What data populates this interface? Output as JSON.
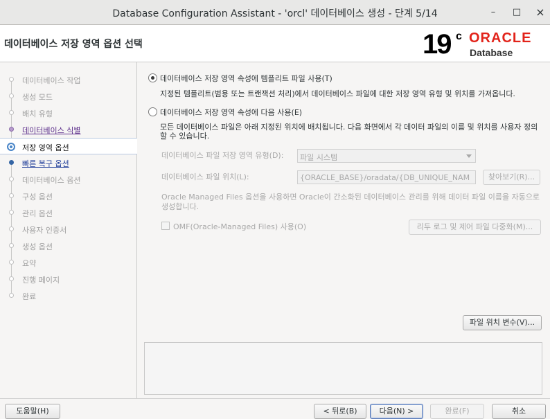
{
  "window": {
    "title": "Database Configuration Assistant - 'orcl' 데이터베이스 생성 - 단계 5/14",
    "minimize_glyph": "–",
    "maximize_glyph": "□",
    "close_glyph": "×"
  },
  "header": {
    "title": "데이터베이스 저장 영역 옵션 선택",
    "logo": {
      "version": "19",
      "superscript": "c",
      "brand": "ORACLE",
      "product": "Database"
    }
  },
  "sidebar": {
    "steps": [
      {
        "label": "데이터베이스 작업",
        "state": "pending"
      },
      {
        "label": "생성 모드",
        "state": "pending"
      },
      {
        "label": "배치 유형",
        "state": "pending"
      },
      {
        "label": "데이터베이스 식별",
        "state": "done"
      },
      {
        "label": "저장 영역 옵션",
        "state": "current"
      },
      {
        "label": "빠른 복구 옵션",
        "state": "next"
      },
      {
        "label": "데이터베이스 옵션",
        "state": "pending"
      },
      {
        "label": "구성 옵션",
        "state": "pending"
      },
      {
        "label": "관리 옵션",
        "state": "pending"
      },
      {
        "label": "사용자 인증서",
        "state": "pending"
      },
      {
        "label": "생성 옵션",
        "state": "pending"
      },
      {
        "label": "요약",
        "state": "pending"
      },
      {
        "label": "진행 페이지",
        "state": "pending"
      },
      {
        "label": "완료",
        "state": "pending"
      }
    ]
  },
  "main": {
    "option_template": {
      "label": "데이터베이스 저장 영역 속성에 템플리트 파일 사용(T)",
      "description": "지정된 템플리트(범용 또는 트랜잭션 처리)에서 데이터베이스 파일에 대한 저장 영역 유형 및 위치를 가져옵니다.",
      "selected": true
    },
    "option_custom": {
      "label": "데이터베이스 저장 영역 속성에 다음 사용(E)",
      "description": "모든 데이터베이스 파일은 아래 지정된 위치에 배치됩니다. 다음 화면에서 각 데이터 파일의 이름 및 위치를 사용자 정의할 수 있습니다.",
      "selected": false
    },
    "storage_type": {
      "label": "데이터베이스 파일 저장 영역 유형(D):",
      "value": "파일 시스템"
    },
    "file_location": {
      "label": "데이터베이스 파일 위치(L):",
      "value": "{ORACLE_BASE}/oradata/{DB_UNIQUE_NAM",
      "browse_label": "찾아보기(R)..."
    },
    "omf_note": "Oracle Managed Files 옵션을 사용하면 Oracle이 간소화된 데이터베이스 관리를 위해 데이터 파일 이름을 자동으로 생성합니다.",
    "omf_checkbox": {
      "label": "OMF(Oracle-Managed Files) 사용(O)",
      "checked": false
    },
    "multiplex_label": "리두 로그 및 제어 파일 다중화(M)...",
    "file_location_vars_label": "파일 위치 변수(V)..."
  },
  "footer": {
    "help_label": "도움말(H)",
    "back_label": "< 뒤로(B)",
    "next_label": "다음(N) >",
    "finish_label": "완료(F)",
    "cancel_label": "취소"
  }
}
